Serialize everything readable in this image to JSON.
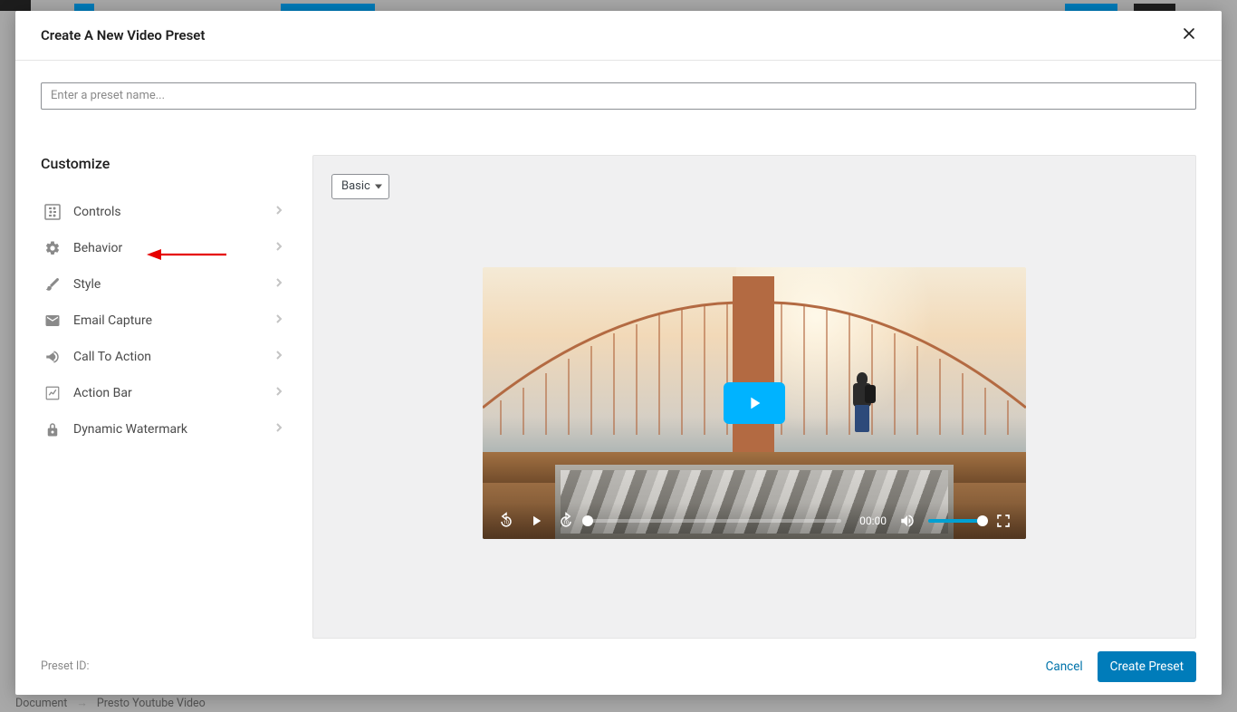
{
  "modal": {
    "title": "Create A New Video Preset",
    "input_placeholder": "Enter a preset name..."
  },
  "sidebar": {
    "title": "Customize",
    "items": [
      {
        "label": "Controls",
        "icon": "controls"
      },
      {
        "label": "Behavior",
        "icon": "gear"
      },
      {
        "label": "Style",
        "icon": "brush"
      },
      {
        "label": "Email Capture",
        "icon": "mail"
      },
      {
        "label": "Call To Action",
        "icon": "megaphone"
      },
      {
        "label": "Action Bar",
        "icon": "chart"
      },
      {
        "label": "Dynamic Watermark",
        "icon": "lock"
      }
    ]
  },
  "preview": {
    "select_value": "Basic",
    "time": "00:00"
  },
  "footer": {
    "preset_id_label": "Preset ID:",
    "cancel": "Cancel",
    "create": "Create Preset"
  },
  "breadcrumb": {
    "a": "Document",
    "sep": "→",
    "b": "Presto Youtube Video"
  },
  "colors": {
    "accent": "#007cba",
    "play": "#00b3ff"
  }
}
